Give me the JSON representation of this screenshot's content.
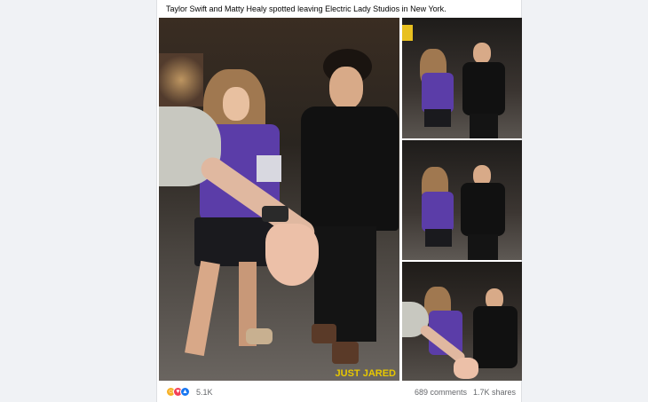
{
  "post": {
    "caption": "Taylor Swift and Matty Healy spotted leaving Electric Lady Studios in New York.",
    "reaction_count": "5.1K",
    "comments": "689 comments",
    "shares": "1.7K shares",
    "reaction_icons": [
      "laugh-icon",
      "love-icon",
      "like-icon"
    ],
    "watermark": "JUST JARED"
  },
  "colors": {
    "page_bg": "#f0f2f5",
    "card_bg": "#ffffff",
    "text_secondary": "#65676b",
    "sweater_purple": "#5b3da8",
    "like_blue": "#1877f2",
    "love_red": "#f33e58",
    "laugh_yellow": "#f7b125"
  }
}
